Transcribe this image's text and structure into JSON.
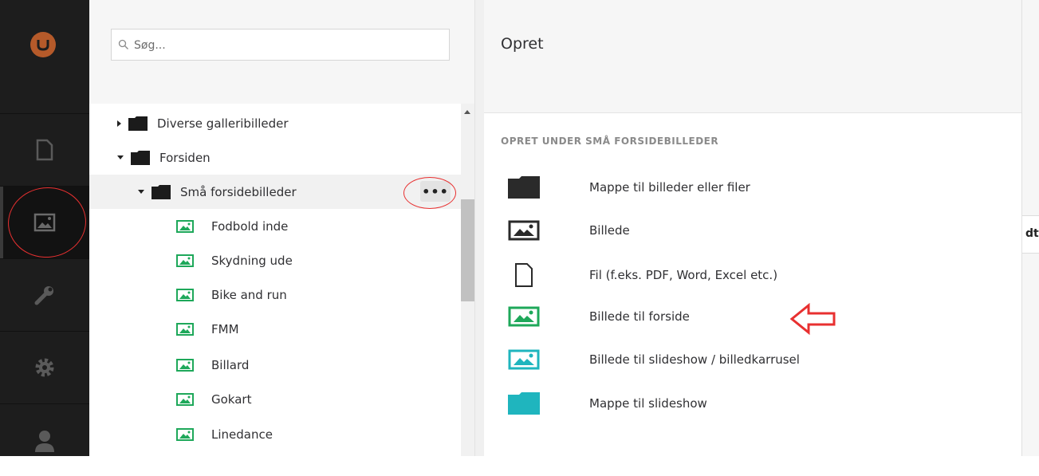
{
  "search": {
    "placeholder": "Søg..."
  },
  "tree": {
    "items": [
      {
        "label": "Diverse galleribilleder",
        "type": "folder",
        "expanded": false
      },
      {
        "label": "Forsiden",
        "type": "folder",
        "expanded": true
      },
      {
        "label": "Små forsidebilleder",
        "type": "folder",
        "expanded": true,
        "selected": true
      },
      {
        "label": "Fodbold inde",
        "type": "image"
      },
      {
        "label": "Skydning ude",
        "type": "image"
      },
      {
        "label": "Bike and run",
        "type": "image"
      },
      {
        "label": "FMM",
        "type": "image"
      },
      {
        "label": "Billard",
        "type": "image"
      },
      {
        "label": "Gokart",
        "type": "image"
      },
      {
        "label": "Linedance",
        "type": "image"
      }
    ],
    "actions_label": "•••"
  },
  "panel": {
    "title": "Opret",
    "section_label": "OPRET UNDER SMÅ FORSIDEBILLEDER",
    "options": [
      {
        "label": "Mappe til billeder eller filer",
        "icon": "folder-icon"
      },
      {
        "label": "Billede",
        "icon": "image-icon"
      },
      {
        "label": "Fil (f.eks. PDF, Word, Excel etc.)",
        "icon": "file-icon"
      },
      {
        "label": "Billede til forside",
        "icon": "image-icon"
      },
      {
        "label": "Billede til slideshow / billedkarrusel",
        "icon": "image-icon"
      },
      {
        "label": "Mappe til slideshow",
        "icon": "folder-icon"
      }
    ]
  },
  "edge": {
    "text": "dt"
  },
  "colors": {
    "green": "#1ea85a",
    "teal": "#1fb5be",
    "annotation_red": "#e83030",
    "sidebar": "#1d1d1d"
  }
}
